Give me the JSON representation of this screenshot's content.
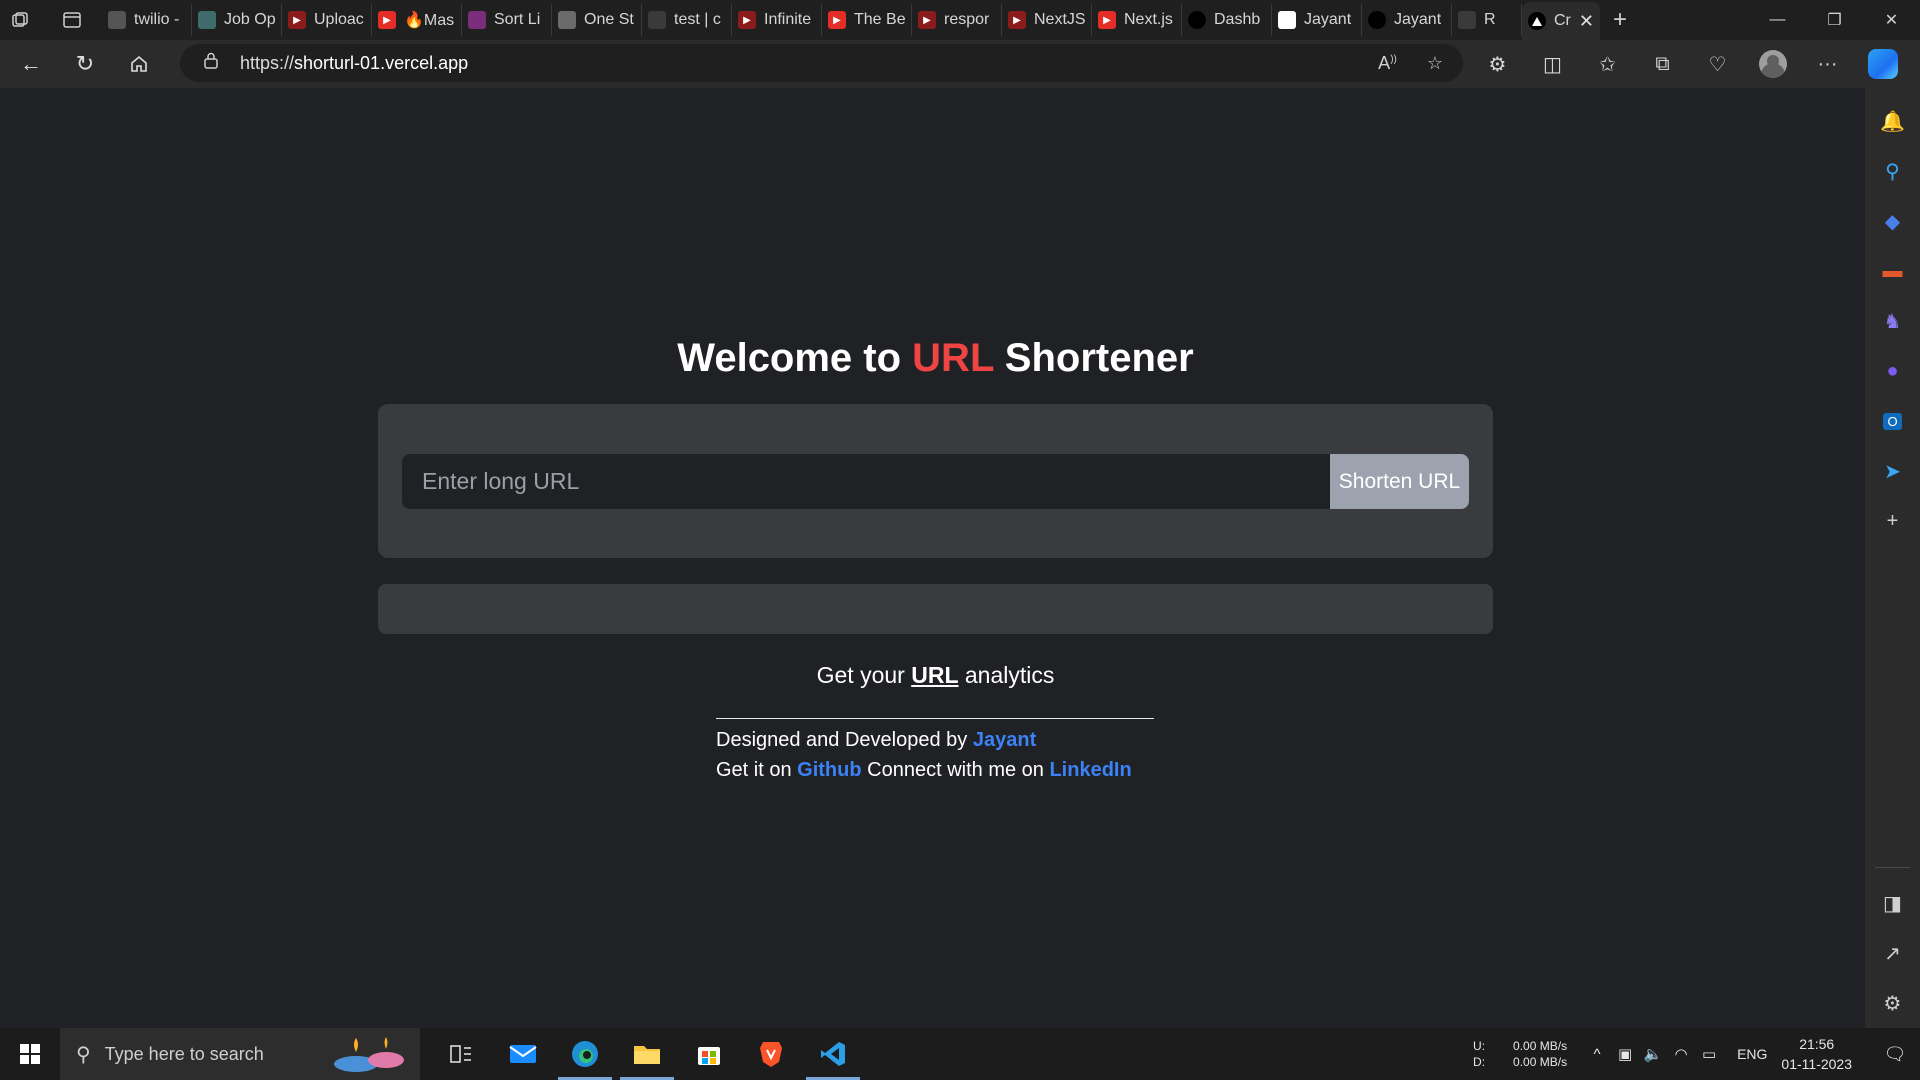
{
  "browser": {
    "tabs": [
      {
        "label": "twilio -",
        "favicon": "google-icon",
        "color": "#555555"
      },
      {
        "label": "Job Op",
        "favicon": "c-icon",
        "color": "#3f6b6b"
      },
      {
        "label": "Uploac",
        "favicon": "youtube-icon",
        "color": "#8b1c1c"
      },
      {
        "label": "🔥Mas",
        "favicon": "youtube-icon",
        "color": "#e52d27"
      },
      {
        "label": "Sort Li",
        "favicon": "t-icon",
        "color": "#7a2e7a"
      },
      {
        "label": "One St",
        "favicon": "globe-icon",
        "color": "#6b6b6b"
      },
      {
        "label": "test | c",
        "favicon": "app-icon",
        "color": "#3a3a3a"
      },
      {
        "label": "Infinite",
        "favicon": "youtube-icon",
        "color": "#8b1c1c"
      },
      {
        "label": "The Be",
        "favicon": "youtube-icon",
        "color": "#e52d27"
      },
      {
        "label": "respor",
        "favicon": "youtube-icon",
        "color": "#8b1c1c"
      },
      {
        "label": "NextJS",
        "favicon": "youtube-icon",
        "color": "#8b1c1c"
      },
      {
        "label": "Next.js",
        "favicon": "youtube-icon",
        "color": "#e52d27"
      },
      {
        "label": "Dashb",
        "favicon": "vercel-icon",
        "color": "#000000"
      },
      {
        "label": "Jayant",
        "favicon": "chart-icon",
        "color": "#ffffff"
      },
      {
        "label": "Jayant",
        "favicon": "github-icon",
        "color": "#000000"
      },
      {
        "label": "R",
        "favicon": "page-icon",
        "color": "#3a3a3a"
      }
    ],
    "active_tab": {
      "label": "Cr",
      "favicon": "vercel-icon"
    },
    "address": {
      "scheme": "https://",
      "host": "shorturl-01.vercel.app"
    }
  },
  "page": {
    "title_pre": "Welcome to ",
    "title_accent": "URL",
    "title_post": " Shortener",
    "input_placeholder": "Enter long URL",
    "button_label": "Shorten URL",
    "analytics_pre": "Get your ",
    "analytics_link": "URL",
    "analytics_post": " analytics",
    "footer_line1_pre": "Designed and Developed by ",
    "footer_author": "Jayant",
    "footer_line2_pre": "Get it on ",
    "footer_github": "Github",
    "footer_line2_mid": " Connect with me on ",
    "footer_linkedin": "LinkedIn"
  },
  "taskbar": {
    "search_placeholder": "Type here to search",
    "net_up_label": "U:",
    "net_down_label": "D:",
    "net_up": "0.00 MB/s",
    "net_down": "0.00 MB/s",
    "language": "ENG",
    "time": "21:56",
    "date": "01-11-2023"
  },
  "colors": {
    "accent_red": "#ef4444",
    "link_blue": "#3b82f6",
    "button_gray": "#9ca3af",
    "card_bg": "#3a3b3f",
    "page_bg": "#202124"
  }
}
